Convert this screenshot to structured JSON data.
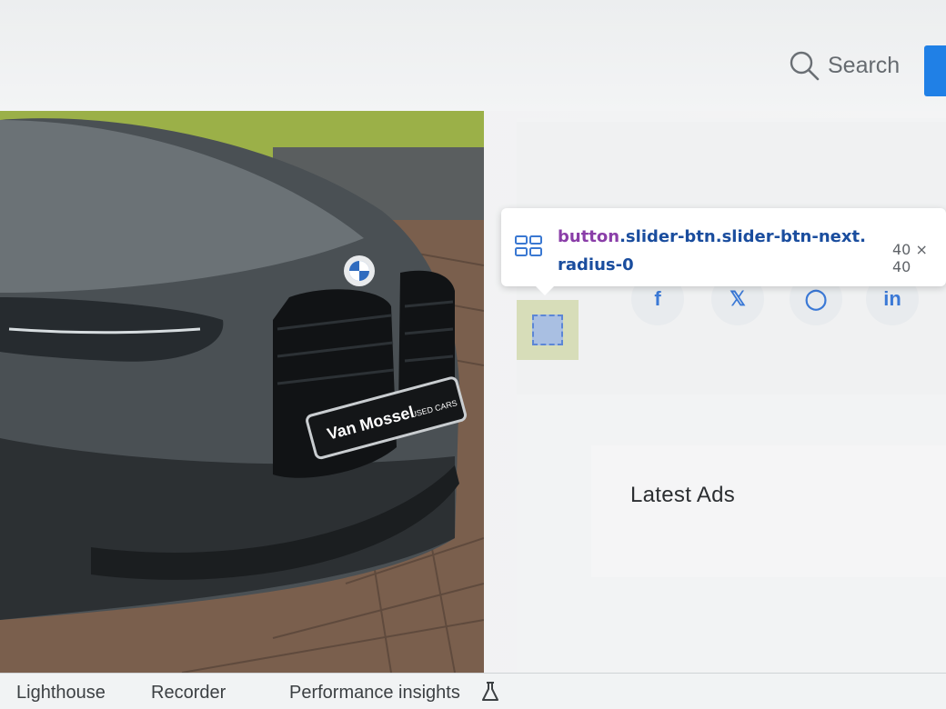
{
  "header": {
    "search_label": "Search"
  },
  "photo": {
    "plate_brand": "Van Mossel",
    "plate_tagline": "USED CARS"
  },
  "tooltip": {
    "tag": "button",
    "selector": ".slider-btn.slider-btn-next.",
    "selector_line2": "radius-0",
    "size": "40 × 40"
  },
  "share": {
    "buttons": [
      {
        "icon": "facebook-icon",
        "glyph": "f"
      },
      {
        "icon": "x-twitter-icon",
        "glyph": "𝕏"
      },
      {
        "icon": "whatsapp-icon",
        "glyph": "◯"
      },
      {
        "icon": "linkedin-icon",
        "glyph": "in"
      }
    ]
  },
  "sidebar": {
    "latest_title": "Latest Ads"
  },
  "devtools": {
    "tabs": [
      "Lighthouse",
      "Recorder",
      "Performance insights"
    ]
  },
  "colors": {
    "accent_blue": "#2080e6",
    "tooltip_tag": "#8a3ea8",
    "tooltip_selector": "#1a4d9e",
    "highlight_margin": "#d7ddb9",
    "highlight_content": "#a9bfe2"
  }
}
